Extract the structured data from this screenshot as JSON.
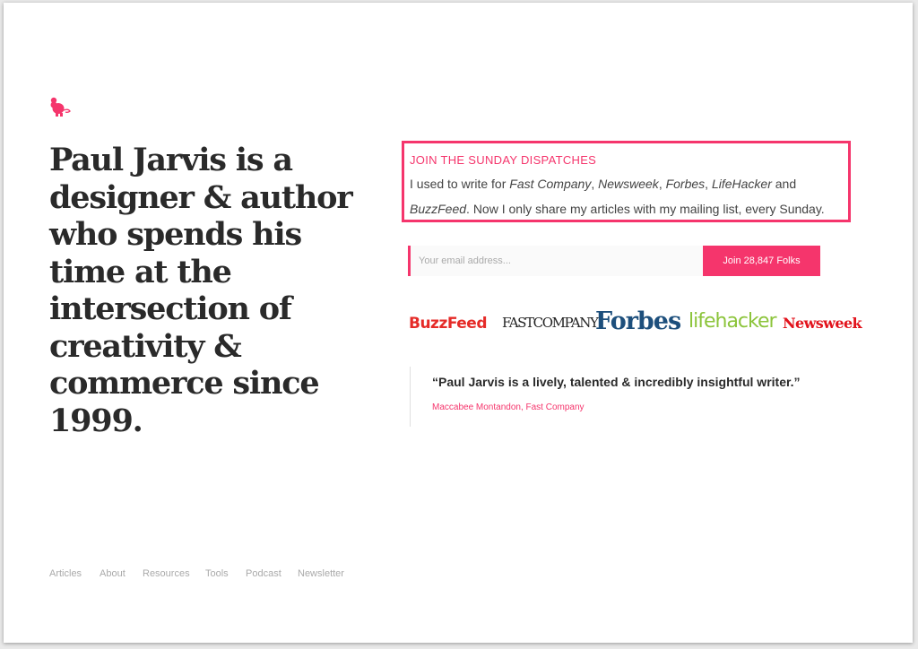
{
  "brand": {
    "logo_icon": "mouse-icon",
    "accent_color": "#f5356c"
  },
  "hero": {
    "headline_lines": [
      "Paul Jarvis is a",
      "designer & author",
      "who spends his",
      "time at the",
      "intersection of",
      "creativity &",
      "commerce since",
      "1999."
    ]
  },
  "signup": {
    "title": "JOIN THE SUNDAY DISPATCHES",
    "text_1": "I used to write for ",
    "pub_1": "Fast Company",
    "sep_1": ", ",
    "pub_2": "Newsweek",
    "sep_2": ", ",
    "pub_3": "Forbes",
    "sep_3": ", ",
    "pub_4": "LifeHacker",
    "text_2": " and ",
    "pub_5": "BuzzFeed",
    "text_3": ". Now I only share my articles with my mailing list, every Sunday.",
    "email_placeholder": "Your email address...",
    "button_label": "Join 28,847 Folks"
  },
  "press_logos": [
    "BuzzFeed",
    "FASTCOMPANY",
    "Forbes",
    "lifehacker",
    "Newsweek"
  ],
  "testimonial": {
    "quote": "“Paul Jarvis is a lively, talented & incredibly insightful writer.”",
    "source": "Maccabee Montandon, Fast Company"
  },
  "footer_nav": [
    "Articles",
    "About",
    "Resources",
    "Tools",
    "Podcast",
    "Newsletter"
  ]
}
